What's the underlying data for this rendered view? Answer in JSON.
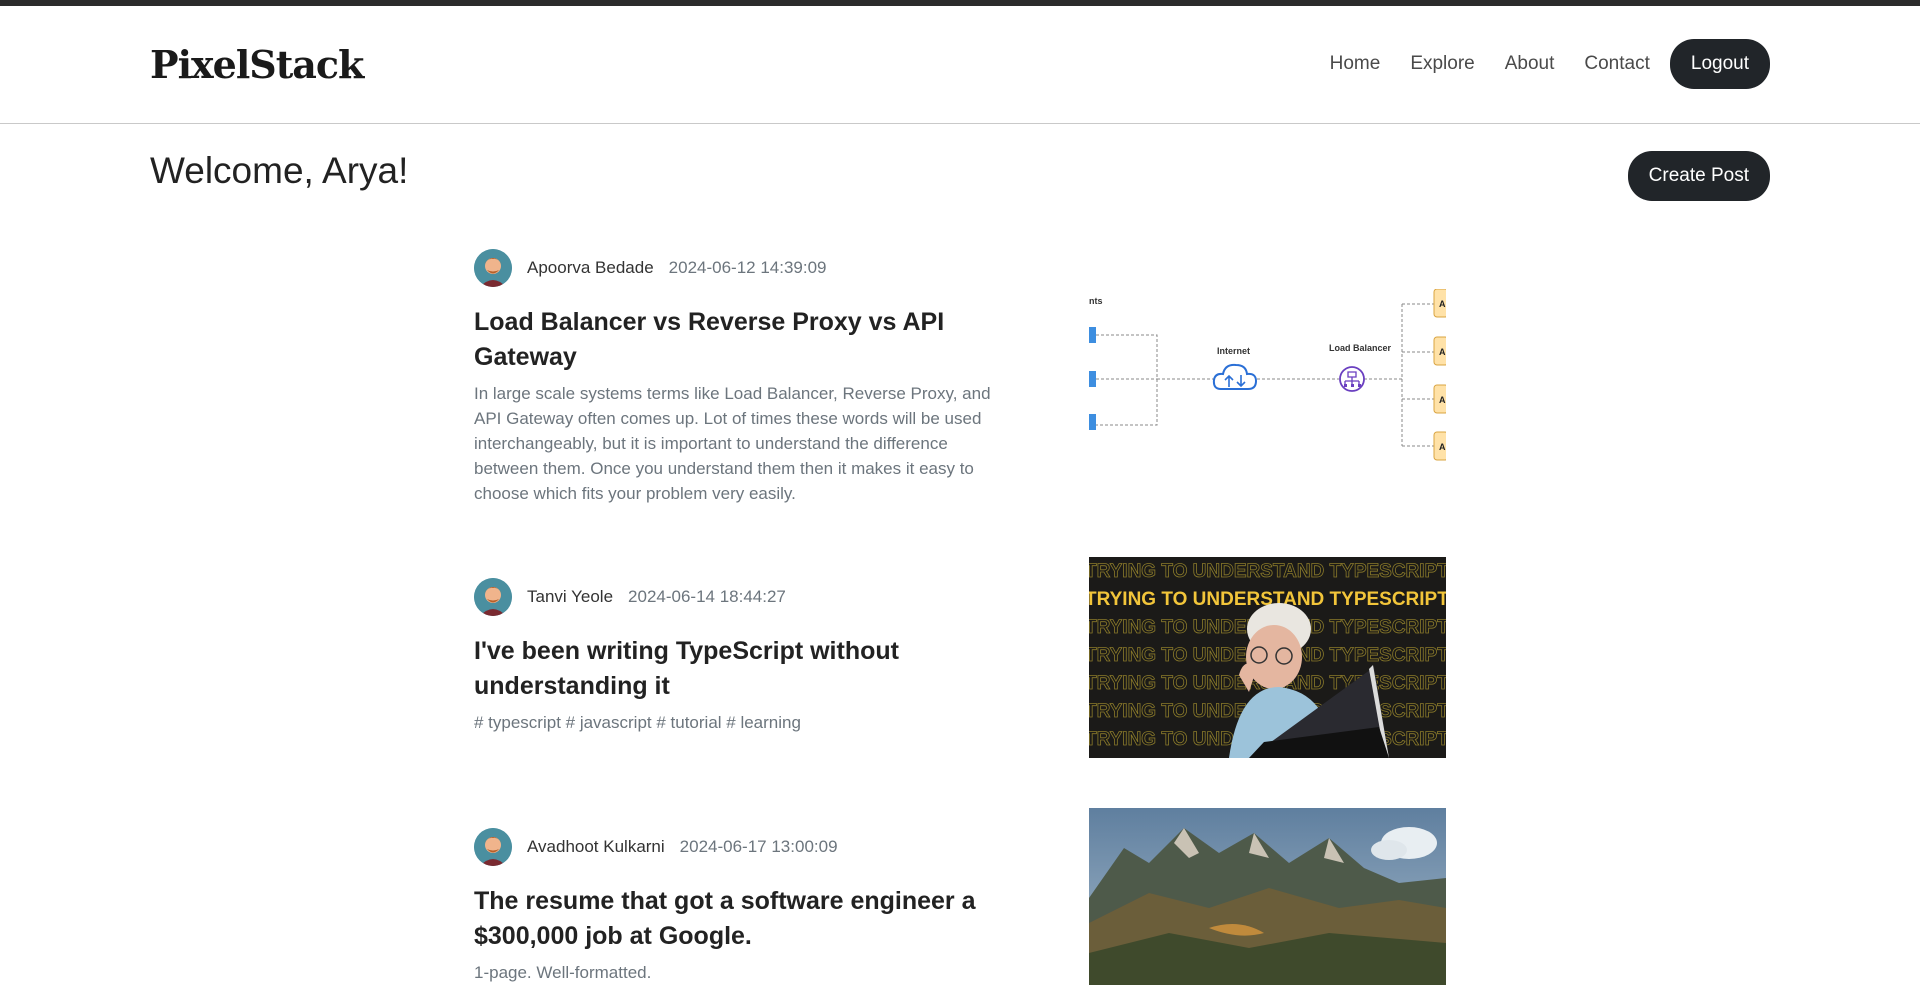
{
  "brand": "PixelStack",
  "nav": {
    "links": [
      "Home",
      "Explore",
      "About",
      "Contact"
    ],
    "logout_label": "Logout"
  },
  "welcome": "Welcome, Arya!",
  "create_label": "Create Post",
  "posts": [
    {
      "author": "Apoorva Bedade",
      "date": "2024-06-12 14:39:09",
      "title": "Load Balancer vs Reverse Proxy vs API Gateway",
      "excerpt": "In large scale systems terms like Load Balancer, Reverse Proxy, and API Gateway often comes up. Lot of times these words will be used interchangeably, but it is important to understand the difference between them. Once you understand them then it makes it easy to choose which fits your problem very easily.",
      "image": {
        "label_clients": "nts",
        "label_internet": "Internet",
        "label_lb": "Load Balancer",
        "server_letter": "A"
      }
    },
    {
      "author": "Tanvi Yeole",
      "date": "2024-06-14 18:44:27",
      "title": "I've been writing TypeScript without understanding it",
      "excerpt": "# typescript # javascript # tutorial # learning",
      "image": {
        "banner_text": "TRYING TO UNDERSTAND TYPESCRIPT"
      }
    },
    {
      "author": "Avadhoot Kulkarni",
      "date": "2024-06-17 13:00:09",
      "title": "The resume that got a software engineer a $300,000 job at Google.",
      "excerpt": "1-page. Well-formatted."
    }
  ]
}
